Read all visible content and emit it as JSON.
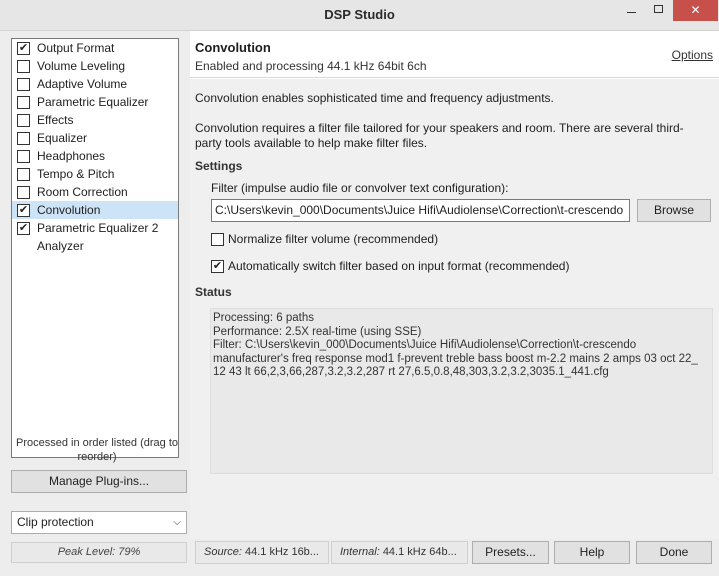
{
  "window": {
    "title": "DSP Studio",
    "close_glyph": "✕"
  },
  "plugins": [
    {
      "label": "Output Format",
      "checked": true,
      "selected": false
    },
    {
      "label": "Volume Leveling",
      "checked": false,
      "selected": false
    },
    {
      "label": "Adaptive Volume",
      "checked": false,
      "selected": false
    },
    {
      "label": "Parametric Equalizer",
      "checked": false,
      "selected": false
    },
    {
      "label": "Effects",
      "checked": false,
      "selected": false
    },
    {
      "label": "Equalizer",
      "checked": false,
      "selected": false
    },
    {
      "label": "Headphones",
      "checked": false,
      "selected": false
    },
    {
      "label": "Tempo & Pitch",
      "checked": false,
      "selected": false
    },
    {
      "label": "Room Correction",
      "checked": false,
      "selected": false
    },
    {
      "label": "Convolution",
      "checked": true,
      "selected": true
    },
    {
      "label": "Parametric Equalizer 2",
      "checked": true,
      "selected": false
    },
    {
      "label": "Analyzer",
      "checked": null,
      "selected": false
    }
  ],
  "left": {
    "order_note": "Processed in order listed (drag to reorder)",
    "manage_button": "Manage Plug-ins...",
    "clip_select": "Clip protection",
    "peak_level": "Peak Level: 79%"
  },
  "header": {
    "title": "Convolution",
    "subtitle": "Enabled and processing 44.1 kHz 64bit 6ch",
    "options_link": "Options"
  },
  "content": {
    "description1": "Convolution enables sophisticated time and frequency adjustments.",
    "description2": "Convolution requires a filter file tailored for your speakers and room.  There are several third-party tools available to help make filter files.",
    "settings_heading": "Settings",
    "filter_label": "Filter (impulse audio file or convolver text configuration):",
    "filter_value": "C:\\Users\\kevin_000\\Documents\\Juice Hifi\\Audiolense\\Correction\\t-crescendo",
    "browse_button": "Browse",
    "normalize_label": "Normalize filter volume (recommended)",
    "normalize_checked": false,
    "autoswitch_label": "Automatically switch filter based on input format (recommended)",
    "autoswitch_checked": true,
    "status_heading": "Status",
    "status_lines": [
      "Processing: 6 paths",
      "Performance: 2.5X real-time (using SSE)",
      "Filter: C:\\Users\\kevin_000\\Documents\\Juice Hifi\\Audiolense\\Correction\\t-crescendo",
      "manufacturer's freq response mod1 f-prevent treble bass boost m-2.2 mains 2 amps 03 oct 22_",
      "12 43 lt 66,2,3,66,287,3.2,3.2,287 rt 27,6.5,0.8,48,303,3.2,3.2,3035.1_441.cfg"
    ]
  },
  "footer": {
    "source_key": "Source:",
    "source_value": "44.1 kHz 16b...",
    "internal_key": "Internal:",
    "internal_value": "44.1 kHz 64b...",
    "presets_button": "Presets...",
    "help_button": "Help",
    "done_button": "Done"
  }
}
